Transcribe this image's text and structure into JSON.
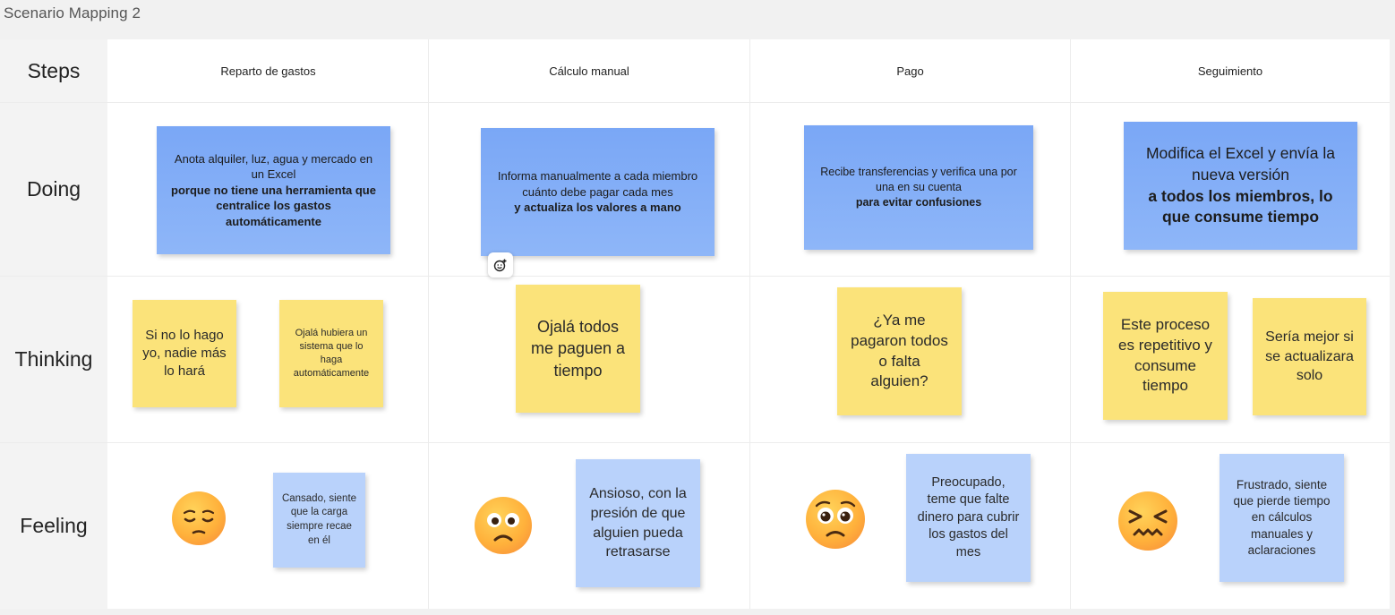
{
  "frame_title": "Scenario Mapping 2",
  "rows": {
    "steps": "Steps",
    "doing": "Doing",
    "thinking": "Thinking",
    "feeling": "Feeling"
  },
  "steps": [
    "Reparto de gastos",
    "Cálculo manual",
    "Pago",
    "Seguimiento"
  ],
  "doing": [
    {
      "pre": "Anota alquiler, luz, agua y mercado en un Excel ",
      "bold": "porque no tiene una herramienta que centralice los gastos automáticamente"
    },
    {
      "pre": "Informa manualmente a cada miembro cuánto debe pagar cada mes ",
      "bold": "y actualiza los valores a mano"
    },
    {
      "pre": "Recibe transferencias y verifica una por una en su cuenta ",
      "bold": "para evitar confusiones"
    },
    {
      "pre": "Modifica el Excel y envía la nueva versión ",
      "bold": "a todos los miembros, lo que consume tiempo"
    }
  ],
  "thinking": [
    "Si no lo hago yo, nadie más lo hará",
    "Ojalá hubiera un sistema que lo haga automáticamente",
    "Ojalá todos me paguen a tiempo",
    "¿Ya me pagaron todos o falta alguien?",
    "Este proceso es repetitivo y consume tiempo",
    "Sería mejor si se actualizara solo"
  ],
  "feeling": [
    {
      "emoji": "pensive-face-icon",
      "text": "Cansado, siente que la carga siempre recae en él"
    },
    {
      "emoji": "worried-face-icon",
      "text": "Ansioso, con la presión de que alguien pueda retrasarse"
    },
    {
      "emoji": "pleading-face-icon",
      "text": "Preocupado, teme que falte dinero para cubrir los gastos del mes"
    },
    {
      "emoji": "confounded-face-icon",
      "text": "Frustrado, siente que pierde tiempo en cálculos manuales y aclaraciones"
    }
  ],
  "colors": {
    "doing_note": "#7aa7f6",
    "thinking_note": "#fbe37a",
    "feeling_note": "#b9d2fb"
  },
  "add_reaction_icon": "add-reaction-icon"
}
